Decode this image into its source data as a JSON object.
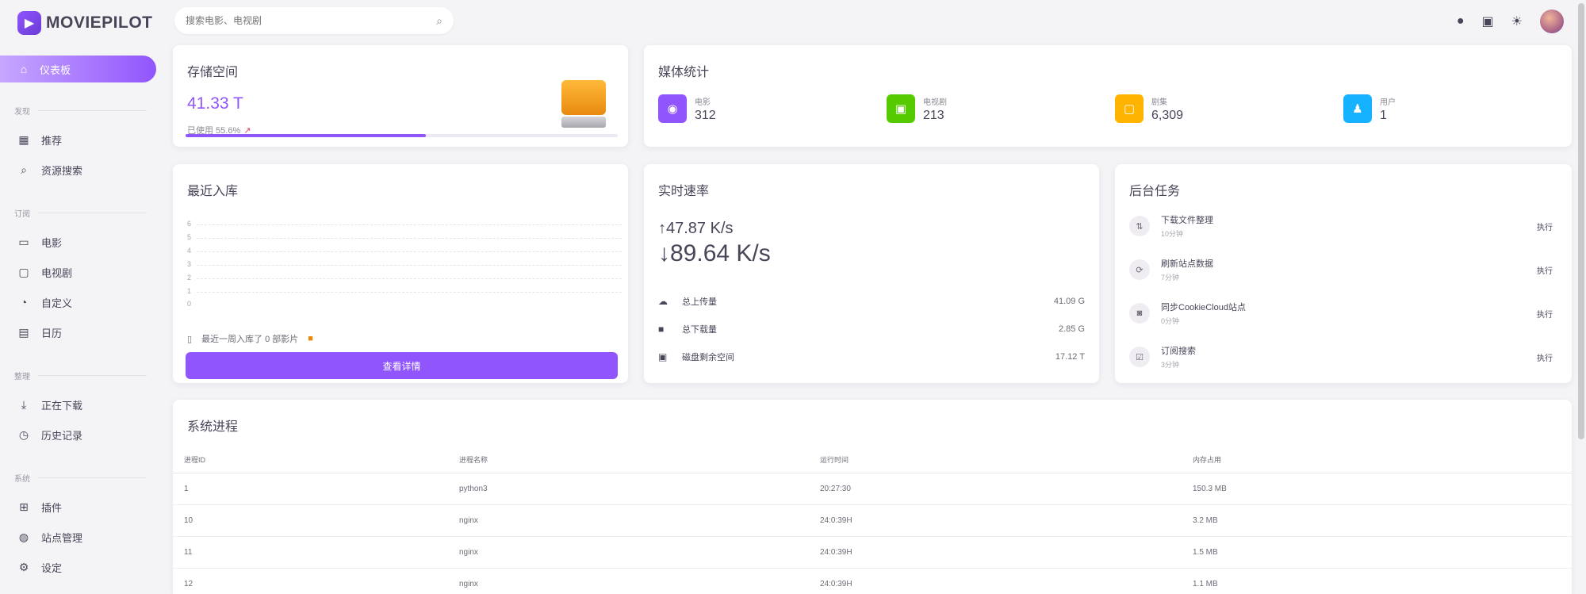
{
  "app": {
    "name": "MOVIEPILOT"
  },
  "sidebar": {
    "active": {
      "label": "仪表板"
    },
    "sections": [
      {
        "title": "发现",
        "items": [
          {
            "label": "推荐"
          },
          {
            "label": "资源搜索"
          }
        ]
      },
      {
        "title": "订阅",
        "items": [
          {
            "label": "电影"
          },
          {
            "label": "电视剧"
          },
          {
            "label": "自定义"
          },
          {
            "label": "日历"
          }
        ]
      },
      {
        "title": "整理",
        "items": [
          {
            "label": "正在下载"
          },
          {
            "label": "历史记录"
          }
        ]
      },
      {
        "title": "系统",
        "items": [
          {
            "label": "插件"
          },
          {
            "label": "站点管理"
          },
          {
            "label": "设定"
          }
        ]
      }
    ]
  },
  "search": {
    "placeholder": "搜索电影、电视剧"
  },
  "storage": {
    "title": "存储空间",
    "value": "41.33 T",
    "used_text": "已使用 55.6%",
    "used_fraction": 0.556
  },
  "media_stats": {
    "title": "媒体统计",
    "items": [
      {
        "label": "电影",
        "value": "312",
        "color": "#9155fd",
        "icon": "movie-icon"
      },
      {
        "label": "电视剧",
        "value": "213",
        "color": "#56ca00",
        "icon": "tv-icon"
      },
      {
        "label": "剧集",
        "value": "6,309",
        "color": "#ffb400",
        "icon": "episode-icon"
      },
      {
        "label": "用户",
        "value": "1",
        "color": "#16b1ff",
        "icon": "user-icon"
      }
    ]
  },
  "recent": {
    "title": "最近入库",
    "ticks": [
      "6",
      "5",
      "4",
      "3",
      "2",
      "1",
      "0"
    ],
    "note": "最近一周入库了 0 部影片",
    "button_label": "查看详情"
  },
  "speed": {
    "title": "实时速率",
    "upload": "↑47.87 K/s",
    "download": "↓89.64 K/s",
    "rows": [
      {
        "label": "总上传量",
        "value": "41.09 G"
      },
      {
        "label": "总下载量",
        "value": "2.85 G"
      },
      {
        "label": "磁盘剩余空间",
        "value": "17.12 T"
      }
    ]
  },
  "tasks": {
    "title": "后台任务",
    "items": [
      {
        "name": "下载文件整理",
        "sub": "10分钟",
        "action": "执行"
      },
      {
        "name": "刷新站点数据",
        "sub": "7分钟",
        "action": "执行"
      },
      {
        "name": "同步CookieCloud站点",
        "sub": "0分钟",
        "action": "执行"
      },
      {
        "name": "订阅搜索",
        "sub": "3分钟",
        "action": "执行"
      }
    ]
  },
  "processes": {
    "title": "系统进程",
    "columns": [
      "进程ID",
      "进程名称",
      "运行时间",
      "内存占用"
    ],
    "rows": [
      [
        "1",
        "python3",
        "20:27:30",
        "150.3 MB"
      ],
      [
        "10",
        "nginx",
        "24:0:39H",
        "3.2 MB"
      ],
      [
        "11",
        "nginx",
        "24:0:39H",
        "1.5 MB"
      ],
      [
        "12",
        "nginx",
        "24:0:39H",
        "1.1 MB"
      ]
    ]
  }
}
